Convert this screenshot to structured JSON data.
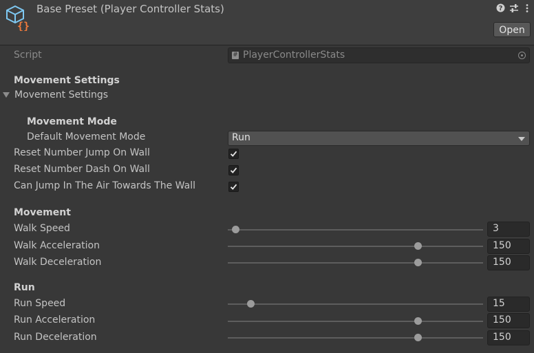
{
  "header": {
    "title": "Base Preset (Player Controller Stats)",
    "open_label": "Open",
    "icons": [
      "scriptable-object-icon",
      "help-icon",
      "preset-settings-icon",
      "kebab-menu-icon"
    ]
  },
  "script_field": {
    "label": "Script",
    "value": "PlayerControllerStats"
  },
  "movement_settings": {
    "header": "Movement Settings",
    "foldout_label": "Movement Settings",
    "expanded": true,
    "movement_mode": {
      "header": "Movement Mode",
      "default_label": "Default Movement Mode",
      "default_value": "Run"
    },
    "toggles": [
      {
        "label": "Reset Number Jump On Wall",
        "checked": true
      },
      {
        "label": "Reset Number Dash On Wall",
        "checked": true
      },
      {
        "label": "Can Jump In The Air Towards The Wall",
        "checked": true
      }
    ]
  },
  "movement": {
    "header": "Movement",
    "sliders": [
      {
        "label": "Walk Speed",
        "value": "3",
        "fraction": 0.03
      },
      {
        "label": "Walk Acceleration",
        "value": "150",
        "fraction": 0.745
      },
      {
        "label": "Walk Deceleration",
        "value": "150",
        "fraction": 0.745
      }
    ]
  },
  "run": {
    "header": "Run",
    "sliders": [
      {
        "label": "Run Speed",
        "value": "15",
        "fraction": 0.09
      },
      {
        "label": "Run Acceleration",
        "value": "150",
        "fraction": 0.745
      },
      {
        "label": "Run Deceleration",
        "value": "150",
        "fraction": 0.745
      }
    ]
  },
  "colors": {
    "background": "#383838",
    "header_bg": "#3e3e3e",
    "icon_blue": "#7ec8f2",
    "icon_orange": "#f07a3c"
  }
}
